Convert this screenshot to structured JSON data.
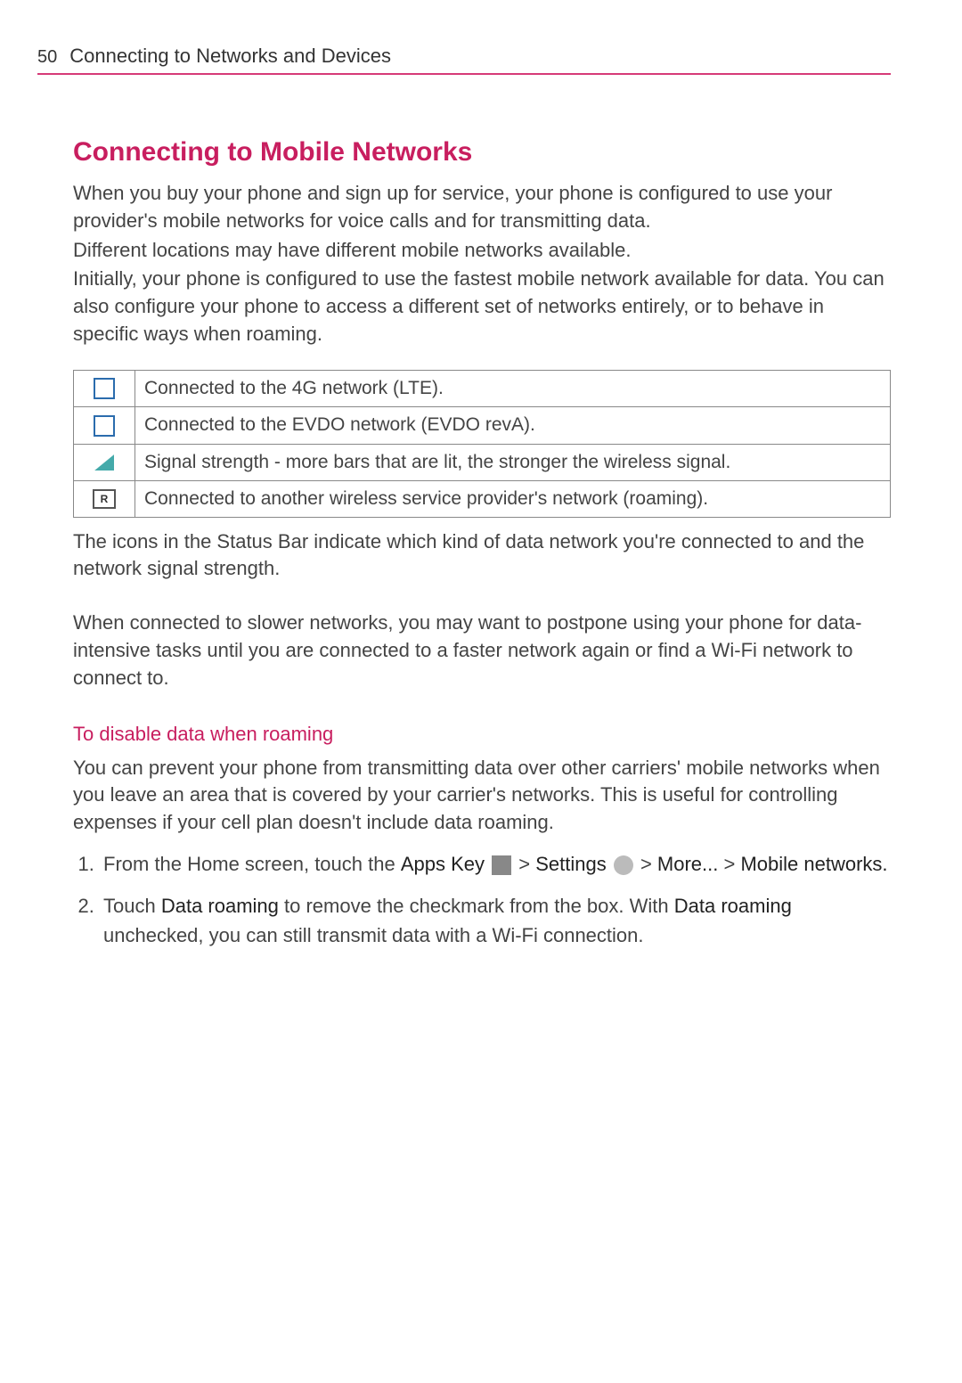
{
  "header": {
    "page_number": "50",
    "chapter": "Connecting to Networks and Devices"
  },
  "section": {
    "title": "Connecting to Mobile Networks",
    "p1": "When you buy your phone and sign up for service, your phone is configured to use your provider's mobile networks for voice calls and for transmitting data.",
    "p2": "Different locations may have different mobile networks available.",
    "p3": "Initially, your phone is configured to use the fastest mobile network available for data. You can also configure your phone to access a different set of networks entirely, or to behave in specific ways when roaming."
  },
  "icon_table": [
    {
      "icon": "4g-icon",
      "desc": "Connected to the 4G network (LTE)."
    },
    {
      "icon": "evdo-icon",
      "desc": "Connected to the EVDO network (EVDO revA)."
    },
    {
      "icon": "signal-icon",
      "desc": "Signal strength -  more bars that are lit, the stronger the wireless signal."
    },
    {
      "icon": "roaming-icon",
      "roam_label": "R",
      "desc": "Connected to another wireless service provider's network (roaming)."
    }
  ],
  "below_table": {
    "p1": "The icons in the Status Bar indicate which kind of data network you're connected to and the network signal strength.",
    "p2": "When connected to slower networks, you may want to postpone using your phone for data-intensive tasks until you are connected to a faster network again or find a Wi-Fi network to connect to."
  },
  "subsection": {
    "heading": "To disable data when roaming",
    "intro": "You can prevent your phone from transmitting data over other carriers' mobile networks when you leave an area that is covered by your carrier's networks. This is useful for controlling expenses if your cell plan doesn't include data roaming."
  },
  "steps": {
    "s1_pre": "From the Home screen, touch the ",
    "s1_apps": "Apps Key",
    "s1_gt1": " > ",
    "s1_settings": "Settings",
    "s1_gt2": " > ",
    "s1_more": "More...",
    "s1_gt3": " > ",
    "s1_mobile": "Mobile networks.",
    "s2_pre": "Touch ",
    "s2_b1": "Data roaming",
    "s2_mid": " to remove the checkmark from the box. With ",
    "s2_b2": "Data roaming",
    "s2_post": " unchecked, you can still transmit data with a Wi-Fi connection."
  }
}
